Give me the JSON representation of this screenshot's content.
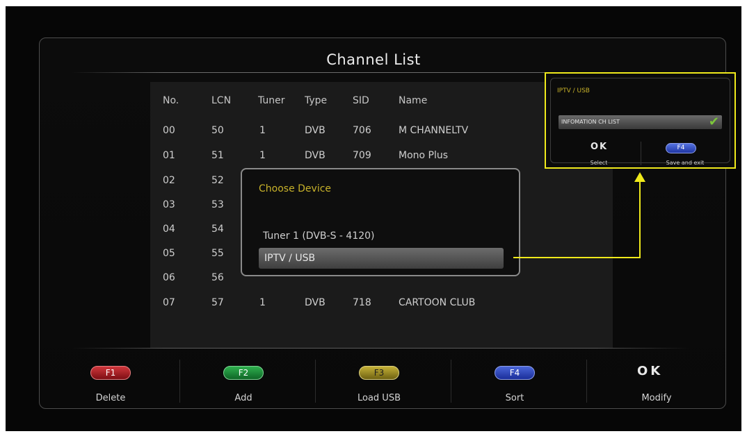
{
  "title": "Channel List",
  "table": {
    "headers": [
      "No.",
      "LCN",
      "Tuner",
      "Type",
      "SID",
      "Name"
    ],
    "rows": [
      {
        "no": "00",
        "lcn": "50",
        "tuner": "1",
        "type": "DVB",
        "sid": "706",
        "name": "M CHANNELTV"
      },
      {
        "no": "01",
        "lcn": "51",
        "tuner": "1",
        "type": "DVB",
        "sid": "709",
        "name": "Mono Plus"
      },
      {
        "no": "02",
        "lcn": "52"
      },
      {
        "no": "03",
        "lcn": "53"
      },
      {
        "no": "04",
        "lcn": "54"
      },
      {
        "no": "05",
        "lcn": "55"
      },
      {
        "no": "06",
        "lcn": "56"
      },
      {
        "no": "07",
        "lcn": "57",
        "tuner": "1",
        "type": "DVB",
        "sid": "718",
        "name": "CARTOON CLUB"
      }
    ]
  },
  "dialog": {
    "title": "Choose Device",
    "options": [
      "Tuner 1 (DVB-S - 4120)",
      "IPTV / USB"
    ],
    "selected": "IPTV / USB"
  },
  "callout": {
    "title": "IPTV / USB",
    "item": "INFOMATION CH LIST",
    "ok_label": "OK",
    "select_label": "Select",
    "f4_label": "F4",
    "save_label": "Save and exit"
  },
  "footer": {
    "buttons": [
      {
        "key": "F1",
        "label": "Delete",
        "color": "#d0363b"
      },
      {
        "key": "F2",
        "label": "Add",
        "color": "#2fb04e"
      },
      {
        "key": "F3",
        "label": "Load USB",
        "color": "#c5b137"
      },
      {
        "key": "F4",
        "label": "Sort",
        "color": "#4a66d8"
      },
      {
        "key": "OK",
        "label": "Modify"
      }
    ]
  },
  "colors": {
    "highlight": "#f0ea1b",
    "accent_text": "#c8b22a",
    "check": "#7cc63a"
  }
}
